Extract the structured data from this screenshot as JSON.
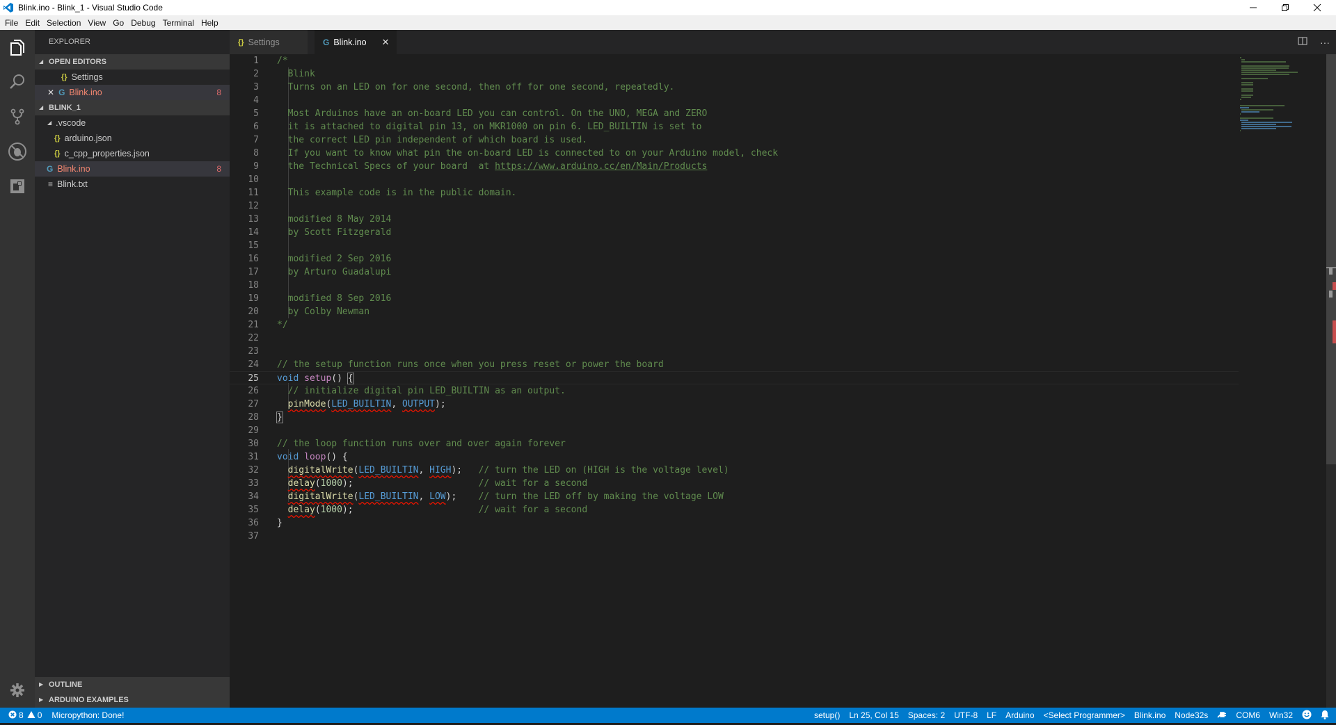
{
  "window": {
    "title": "Blink.ino - Blink_1 - Visual Studio Code",
    "controls": {
      "minimize": "—",
      "restore": "❐",
      "close": "✕"
    }
  },
  "menu": [
    "File",
    "Edit",
    "Selection",
    "View",
    "Go",
    "Debug",
    "Terminal",
    "Help"
  ],
  "activity_bar": [
    "explorer-icon",
    "search-icon",
    "source-control-icon",
    "debug-icon",
    "extensions-icon",
    "gear-icon"
  ],
  "sidebar": {
    "title": "EXPLORER",
    "open_editors": {
      "label": "OPEN EDITORS",
      "items": [
        {
          "name": "Settings",
          "icon": "json-icon",
          "badge": ""
        },
        {
          "name": "Blink.ino",
          "icon": "cpp-icon",
          "badge": "8",
          "close": "✕"
        }
      ]
    },
    "folder": {
      "label": "BLINK_1",
      "items": [
        {
          "name": ".vscode",
          "type": "folder"
        },
        {
          "name": "arduino.json",
          "icon": "json-icon"
        },
        {
          "name": "c_cpp_properties.json",
          "icon": "json-icon"
        },
        {
          "name": "Blink.ino",
          "icon": "cpp-icon",
          "badge": "8"
        },
        {
          "name": "Blink.txt",
          "icon": "text-icon"
        }
      ]
    },
    "outline_label": "OUTLINE",
    "arduino_examples_label": "ARDUINO EXAMPLES"
  },
  "tabs": [
    {
      "label": "Settings",
      "icon": "{}"
    },
    {
      "label": "Blink.ino",
      "icon": "G",
      "close": "✕"
    }
  ],
  "tab_actions": {
    "split": "split-editor-icon",
    "more": "···"
  },
  "editor": {
    "current_line": 25,
    "lines": [
      "/*",
      "  Blink",
      "  Turns on an LED on for one second, then off for one second, repeatedly.",
      "",
      "  Most Arduinos have an on-board LED you can control. On the UNO, MEGA and ZERO",
      "  it is attached to digital pin 13, on MKR1000 on pin 6. LED_BUILTIN is set to",
      "  the correct LED pin independent of which board is used.",
      "  If you want to know what pin the on-board LED is connected to on your Arduino model, check",
      "  the Technical Specs of your board  at https://www.arduino.cc/en/Main/Products",
      "",
      "  This example code is in the public domain.",
      "",
      "  modified 8 May 2014",
      "  by Scott Fitzgerald",
      "",
      "  modified 2 Sep 2016",
      "  by Arturo Guadalupi",
      "",
      "  modified 8 Sep 2016",
      "  by Colby Newman",
      "*/",
      "",
      "",
      "// the setup function runs once when you press reset or power the board",
      "void setup() {",
      "  // initialize digital pin LED_BUILTIN as an output.",
      "  pinMode(LED_BUILTIN, OUTPUT);",
      "}",
      "",
      "// the loop function runs over and over again forever",
      "void loop() {",
      "  digitalWrite(LED_BUILTIN, HIGH);   // turn the LED on (HIGH is the voltage level)",
      "  delay(1000);                       // wait for a second",
      "  digitalWrite(LED_BUILTIN, LOW);    // turn the LED off by making the voltage LOW",
      "  delay(1000);                       // wait for a second",
      "}",
      ""
    ]
  },
  "statusbar": {
    "errors": "8",
    "warnings": "0",
    "message": "Micropython: Done!",
    "function": "setup()",
    "position": "Ln 25, Col 15",
    "indent": "Spaces: 2",
    "encoding": "UTF-8",
    "eol": "LF",
    "language": "Arduino",
    "programmer": "<Select Programmer>",
    "sketch": "Blink.ino",
    "board": "Node32s",
    "port": "COM6",
    "platform": "Win32"
  },
  "colors": {
    "status_bar": "#007acc",
    "comment": "#608b4e",
    "keyword": "#569cd6",
    "error": "#f48771"
  }
}
